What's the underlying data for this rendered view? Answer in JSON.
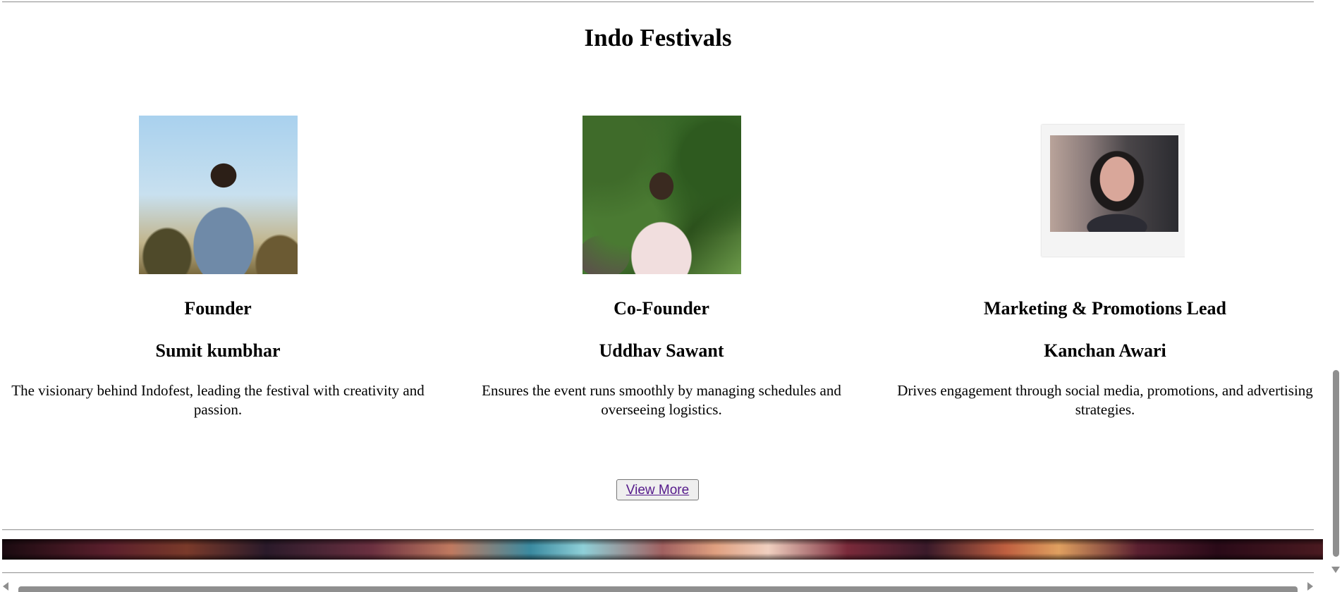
{
  "page": {
    "title": "Indo Festivals"
  },
  "team": {
    "members": [
      {
        "role": "Founder",
        "name": "Sumit kumbhar",
        "description": "The visionary behind Indofest, leading the festival with creativity and passion."
      },
      {
        "role": "Co-Founder",
        "name": "Uddhav Sawant",
        "description": "Ensures the event runs smoothly by managing schedules and overseeing logistics."
      },
      {
        "role": "Marketing & Promotions Lead",
        "name": "Kanchan Awari",
        "description": "Drives engagement through social media, promotions, and advertising strategies."
      }
    ]
  },
  "actions": {
    "view_more_label": "View More"
  },
  "colors": {
    "link": "#551a8b",
    "button_bg": "#efefef",
    "scrollbar": "#8f8f8f"
  }
}
